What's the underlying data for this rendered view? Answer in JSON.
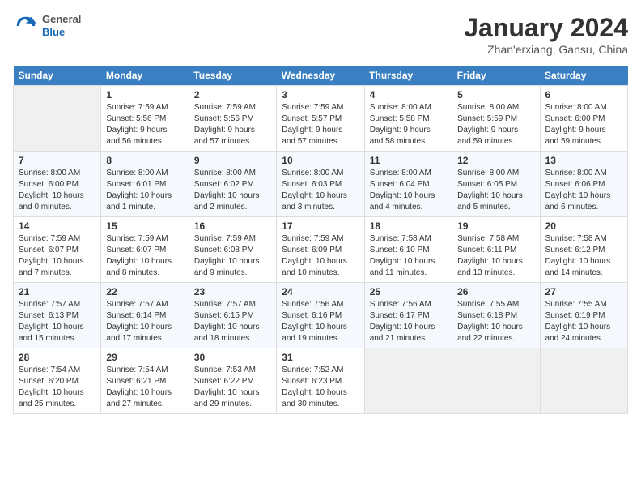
{
  "header": {
    "logo": {
      "general": "General",
      "blue": "Blue"
    },
    "title": "January 2024",
    "location": "Zhan'erxiang, Gansu, China"
  },
  "days_of_week": [
    "Sunday",
    "Monday",
    "Tuesday",
    "Wednesday",
    "Thursday",
    "Friday",
    "Saturday"
  ],
  "weeks": [
    [
      {
        "day": "",
        "info": ""
      },
      {
        "day": "1",
        "info": "Sunrise: 7:59 AM\nSunset: 5:56 PM\nDaylight: 9 hours\nand 56 minutes."
      },
      {
        "day": "2",
        "info": "Sunrise: 7:59 AM\nSunset: 5:56 PM\nDaylight: 9 hours\nand 57 minutes."
      },
      {
        "day": "3",
        "info": "Sunrise: 7:59 AM\nSunset: 5:57 PM\nDaylight: 9 hours\nand 57 minutes."
      },
      {
        "day": "4",
        "info": "Sunrise: 8:00 AM\nSunset: 5:58 PM\nDaylight: 9 hours\nand 58 minutes."
      },
      {
        "day": "5",
        "info": "Sunrise: 8:00 AM\nSunset: 5:59 PM\nDaylight: 9 hours\nand 59 minutes."
      },
      {
        "day": "6",
        "info": "Sunrise: 8:00 AM\nSunset: 6:00 PM\nDaylight: 9 hours\nand 59 minutes."
      }
    ],
    [
      {
        "day": "7",
        "info": "Sunrise: 8:00 AM\nSunset: 6:00 PM\nDaylight: 10 hours\nand 0 minutes."
      },
      {
        "day": "8",
        "info": "Sunrise: 8:00 AM\nSunset: 6:01 PM\nDaylight: 10 hours\nand 1 minute."
      },
      {
        "day": "9",
        "info": "Sunrise: 8:00 AM\nSunset: 6:02 PM\nDaylight: 10 hours\nand 2 minutes."
      },
      {
        "day": "10",
        "info": "Sunrise: 8:00 AM\nSunset: 6:03 PM\nDaylight: 10 hours\nand 3 minutes."
      },
      {
        "day": "11",
        "info": "Sunrise: 8:00 AM\nSunset: 6:04 PM\nDaylight: 10 hours\nand 4 minutes."
      },
      {
        "day": "12",
        "info": "Sunrise: 8:00 AM\nSunset: 6:05 PM\nDaylight: 10 hours\nand 5 minutes."
      },
      {
        "day": "13",
        "info": "Sunrise: 8:00 AM\nSunset: 6:06 PM\nDaylight: 10 hours\nand 6 minutes."
      }
    ],
    [
      {
        "day": "14",
        "info": "Sunrise: 7:59 AM\nSunset: 6:07 PM\nDaylight: 10 hours\nand 7 minutes."
      },
      {
        "day": "15",
        "info": "Sunrise: 7:59 AM\nSunset: 6:07 PM\nDaylight: 10 hours\nand 8 minutes."
      },
      {
        "day": "16",
        "info": "Sunrise: 7:59 AM\nSunset: 6:08 PM\nDaylight: 10 hours\nand 9 minutes."
      },
      {
        "day": "17",
        "info": "Sunrise: 7:59 AM\nSunset: 6:09 PM\nDaylight: 10 hours\nand 10 minutes."
      },
      {
        "day": "18",
        "info": "Sunrise: 7:58 AM\nSunset: 6:10 PM\nDaylight: 10 hours\nand 11 minutes."
      },
      {
        "day": "19",
        "info": "Sunrise: 7:58 AM\nSunset: 6:11 PM\nDaylight: 10 hours\nand 13 minutes."
      },
      {
        "day": "20",
        "info": "Sunrise: 7:58 AM\nSunset: 6:12 PM\nDaylight: 10 hours\nand 14 minutes."
      }
    ],
    [
      {
        "day": "21",
        "info": "Sunrise: 7:57 AM\nSunset: 6:13 PM\nDaylight: 10 hours\nand 15 minutes."
      },
      {
        "day": "22",
        "info": "Sunrise: 7:57 AM\nSunset: 6:14 PM\nDaylight: 10 hours\nand 17 minutes."
      },
      {
        "day": "23",
        "info": "Sunrise: 7:57 AM\nSunset: 6:15 PM\nDaylight: 10 hours\nand 18 minutes."
      },
      {
        "day": "24",
        "info": "Sunrise: 7:56 AM\nSunset: 6:16 PM\nDaylight: 10 hours\nand 19 minutes."
      },
      {
        "day": "25",
        "info": "Sunrise: 7:56 AM\nSunset: 6:17 PM\nDaylight: 10 hours\nand 21 minutes."
      },
      {
        "day": "26",
        "info": "Sunrise: 7:55 AM\nSunset: 6:18 PM\nDaylight: 10 hours\nand 22 minutes."
      },
      {
        "day": "27",
        "info": "Sunrise: 7:55 AM\nSunset: 6:19 PM\nDaylight: 10 hours\nand 24 minutes."
      }
    ],
    [
      {
        "day": "28",
        "info": "Sunrise: 7:54 AM\nSunset: 6:20 PM\nDaylight: 10 hours\nand 25 minutes."
      },
      {
        "day": "29",
        "info": "Sunrise: 7:54 AM\nSunset: 6:21 PM\nDaylight: 10 hours\nand 27 minutes."
      },
      {
        "day": "30",
        "info": "Sunrise: 7:53 AM\nSunset: 6:22 PM\nDaylight: 10 hours\nand 29 minutes."
      },
      {
        "day": "31",
        "info": "Sunrise: 7:52 AM\nSunset: 6:23 PM\nDaylight: 10 hours\nand 30 minutes."
      },
      {
        "day": "",
        "info": ""
      },
      {
        "day": "",
        "info": ""
      },
      {
        "day": "",
        "info": ""
      }
    ]
  ]
}
